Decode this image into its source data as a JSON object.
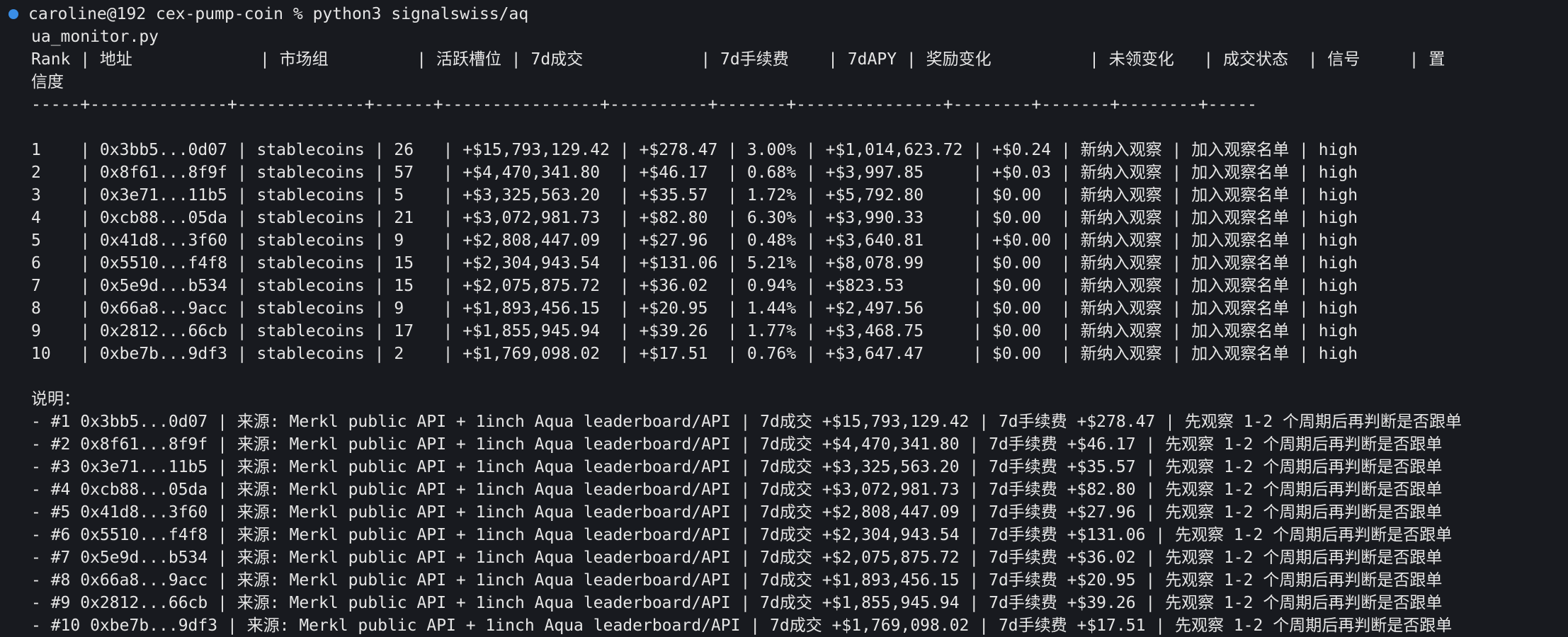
{
  "prompt": {
    "command_line": "caroline@192 cex-pump-coin % python3 signalswiss/aq",
    "command_wrap": "ua_monitor.py",
    "status_color": "#3a8ee6"
  },
  "table": {
    "header_line_1": "Rank | 地址             | 市场组         | 活跃槽位 | 7d成交            | 7d手续费    | 7dAPY | 奖励变化          | 未领变化   | 成交状态  | 信号     | 置",
    "header_line_2": "信度",
    "separator": "-----+--------------+-------------+------+----------------+----------+-------+---------------+--------+-------+--------+-----",
    "rows": [
      "1    | 0x3bb5...0d07 | stablecoins | 26   | +$15,793,129.42 | +$278.47 | 3.00% | +$1,014,623.72 | +$0.24 | 新纳入观察 | 加入观察名单 | high",
      "2    | 0x8f61...8f9f | stablecoins | 57   | +$4,470,341.80  | +$46.17  | 0.68% | +$3,997.85     | +$0.03 | 新纳入观察 | 加入观察名单 | high",
      "3    | 0x3e71...11b5 | stablecoins | 5    | +$3,325,563.20  | +$35.57  | 1.72% | +$5,792.80     | $0.00  | 新纳入观察 | 加入观察名单 | high",
      "4    | 0xcb88...05da | stablecoins | 21   | +$3,072,981.73  | +$82.80  | 6.30% | +$3,990.33     | $0.00  | 新纳入观察 | 加入观察名单 | high",
      "5    | 0x41d8...3f60 | stablecoins | 9    | +$2,808,447.09  | +$27.96  | 0.48% | +$3,640.81     | +$0.00 | 新纳入观察 | 加入观察名单 | high",
      "6    | 0x5510...f4f8 | stablecoins | 15   | +$2,304,943.54  | +$131.06 | 5.21% | +$8,078.99     | $0.00  | 新纳入观察 | 加入观察名单 | high",
      "7    | 0x5e9d...b534 | stablecoins | 15   | +$2,075,875.72  | +$36.02  | 0.94% | +$823.53       | $0.00  | 新纳入观察 | 加入观察名单 | high",
      "8    | 0x66a8...9acc | stablecoins | 9    | +$1,893,456.15  | +$20.95  | 1.44% | +$2,497.56     | $0.00  | 新纳入观察 | 加入观察名单 | high",
      "9    | 0x2812...66cb | stablecoins | 17   | +$1,855,945.94  | +$39.26  | 1.77% | +$3,468.75     | $0.00  | 新纳入观察 | 加入观察名单 | high",
      "10   | 0xbe7b...9df3 | stablecoins | 2    | +$1,769,098.02  | +$17.51  | 0.76% | +$3,647.47     | $0.00  | 新纳入观察 | 加入观察名单 | high"
    ]
  },
  "notes": {
    "title": "说明：",
    "items": [
      "- #1 0x3bb5...0d07 | 来源: Merkl public API + 1inch Aqua leaderboard/API | 7d成交 +$15,793,129.42 | 7d手续费 +$278.47 | 先观察 1-2 个周期后再判断是否跟单",
      "- #2 0x8f61...8f9f | 来源: Merkl public API + 1inch Aqua leaderboard/API | 7d成交 +$4,470,341.80 | 7d手续费 +$46.17 | 先观察 1-2 个周期后再判断是否跟单",
      "- #3 0x3e71...11b5 | 来源: Merkl public API + 1inch Aqua leaderboard/API | 7d成交 +$3,325,563.20 | 7d手续费 +$35.57 | 先观察 1-2 个周期后再判断是否跟单",
      "- #4 0xcb88...05da | 来源: Merkl public API + 1inch Aqua leaderboard/API | 7d成交 +$3,072,981.73 | 7d手续费 +$82.80 | 先观察 1-2 个周期后再判断是否跟单",
      "- #5 0x41d8...3f60 | 来源: Merkl public API + 1inch Aqua leaderboard/API | 7d成交 +$2,808,447.09 | 7d手续费 +$27.96 | 先观察 1-2 个周期后再判断是否跟单",
      "- #6 0x5510...f4f8 | 来源: Merkl public API + 1inch Aqua leaderboard/API | 7d成交 +$2,304,943.54 | 7d手续费 +$131.06 | 先观察 1-2 个周期后再判断是否跟单",
      "- #7 0x5e9d...b534 | 来源: Merkl public API + 1inch Aqua leaderboard/API | 7d成交 +$2,075,875.72 | 7d手续费 +$36.02 | 先观察 1-2 个周期后再判断是否跟单",
      "- #8 0x66a8...9acc | 来源: Merkl public API + 1inch Aqua leaderboard/API | 7d成交 +$1,893,456.15 | 7d手续费 +$20.95 | 先观察 1-2 个周期后再判断是否跟单",
      "- #9 0x2812...66cb | 来源: Merkl public API + 1inch Aqua leaderboard/API | 7d成交 +$1,855,945.94 | 7d手续费 +$39.26 | 先观察 1-2 个周期后再判断是否跟单",
      "- #10 0xbe7b...9df3 | 来源: Merkl public API + 1inch Aqua leaderboard/API | 7d成交 +$1,769,098.02 | 7d手续费 +$17.51 | 先观察 1-2 个周期后再判断是否跟单"
    ]
  }
}
